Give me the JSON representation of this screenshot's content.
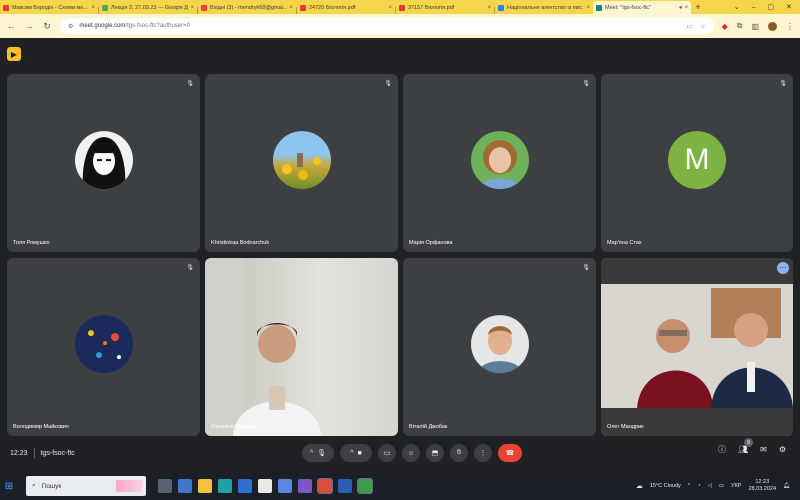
{
  "tabs": [
    {
      "title": "Максим Бородін - Схеми ме...",
      "color": "#e53935"
    },
    {
      "title": "Лекція 2, 27.03.23 — Google Д...",
      "color": "#4caf50"
    },
    {
      "title": "Вхідні (3) - mendryk68@gmai...",
      "color": "#ea4335"
    },
    {
      "title": "24720 Біологія.pdf",
      "color": "#e53935"
    },
    {
      "title": "37157 Біологія.pdf",
      "color": "#e53935"
    },
    {
      "title": "Національне агентство із якіс...",
      "color": "#1e88e5"
    },
    {
      "title": "Meet: \"tgs-fsoc-ftc\"",
      "color": "#00897b",
      "active": true
    }
  ],
  "address": {
    "host": "meet.google.com",
    "path": "/tgs-fsoc-ftc?authuser=0"
  },
  "participants": [
    {
      "name": "Толя Ромушко",
      "avatar": "#e0e0e0"
    },
    {
      "name": "Khristinkaa Bodnarchuk",
      "avatar": "#cdb44a"
    },
    {
      "name": "Марія Орфанова",
      "avatar": "#b78c55"
    },
    {
      "name": "Мар'яна Стах",
      "avatar": "#7cb342",
      "initial": "M"
    },
    {
      "name": "Володимир Майкович",
      "avatar": "#1b2a5a"
    },
    {
      "name": "Михайло Мандрик",
      "avatar": "#b8b8b2"
    },
    {
      "name": "Віталій Джобак",
      "avatar": "#b59b7a"
    },
    {
      "name": "Олег Мандрик",
      "avatar": "#9c7b5e"
    }
  ],
  "meeting": {
    "time": "12:23",
    "code": "tgs-fsoc-ftc",
    "participant_count": "8"
  },
  "taskbar": {
    "search": "Пошук",
    "weather": "15°C Cloudy",
    "lang": "УКР",
    "time": "12:23",
    "date": "28.03.2024"
  }
}
